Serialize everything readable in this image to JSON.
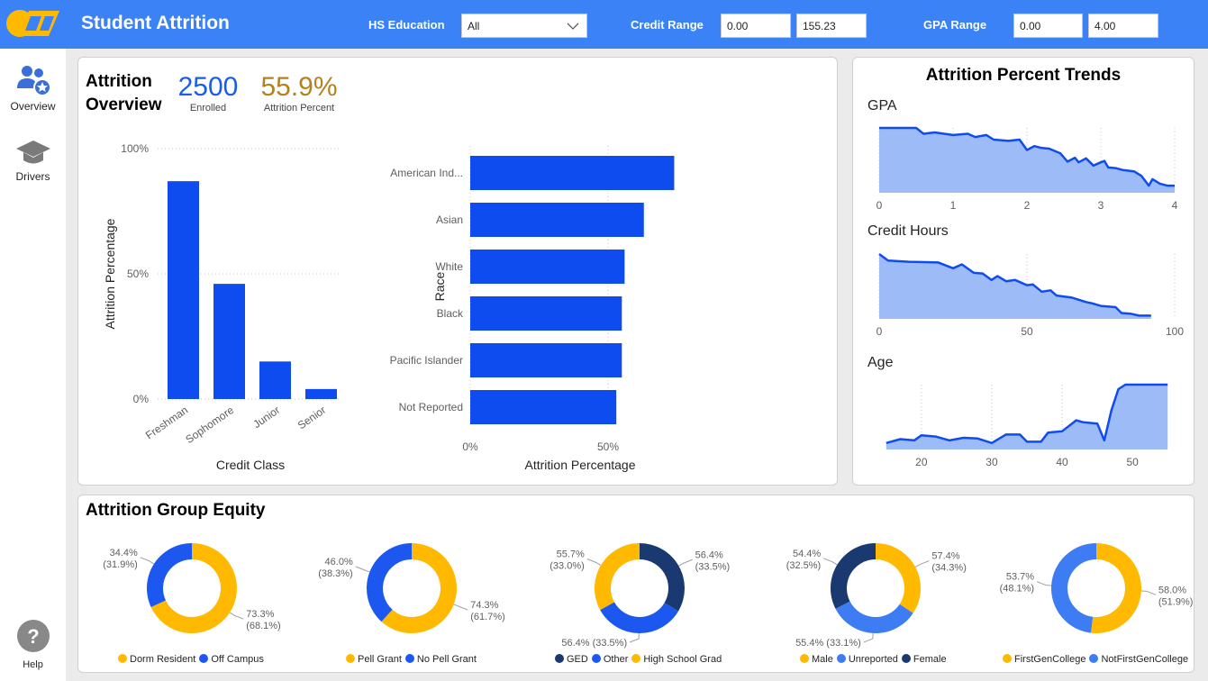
{
  "header": {
    "title": "Student Attrition",
    "hs_education_label": "HS Education",
    "hs_education_value": "All",
    "credit_range_label": "Credit Range",
    "credit_min": "0.00",
    "credit_max": "155.23",
    "gpa_range_label": "GPA Range",
    "gpa_min": "0.00",
    "gpa_max": "4.00"
  },
  "nav": {
    "overview_label": "Overview",
    "drivers_label": "Drivers",
    "help_label": "Help"
  },
  "overview": {
    "title_line1": "Attrition",
    "title_line2": "Overview",
    "enrolled_value": "2500",
    "enrolled_label": "Enrolled",
    "attrition_value": "55.9%",
    "attrition_label": "Attrition Percent",
    "kpi_colors": {
      "enrolled": "#1a5ce6",
      "attrition": "#b5811e"
    }
  },
  "trends": {
    "title": "Attrition Percent Trends",
    "gpa_label": "GPA",
    "credit_label": "Credit Hours",
    "age_label": "Age"
  },
  "equity": {
    "title": "Attrition Group Equity"
  },
  "colors": {
    "brand": "#3b82f6",
    "bar": "#0f4cf0",
    "area_fill": "#9dbcf7",
    "gold": "#ffb900",
    "blue": "#1c58f0",
    "mid_blue": "#3d7cf2",
    "navy": "#1a3970"
  },
  "chart_data": [
    {
      "type": "bar",
      "id": "credit-class",
      "categories": [
        "Freshman",
        "Sophomore",
        "Junior",
        "Senior"
      ],
      "values": [
        87,
        46,
        15,
        4
      ],
      "xlabel": "Credit Class",
      "ylabel": "Attrition Percentage",
      "ylim": [
        0,
        100
      ],
      "yticks": [
        "0%",
        "50%",
        "100%"
      ]
    },
    {
      "type": "bar",
      "id": "race",
      "orientation": "horizontal",
      "categories": [
        "American Ind...",
        "Asian",
        "White",
        "Black",
        "Pacific Islander",
        "Not Reported"
      ],
      "values": [
        74,
        63,
        56,
        55,
        55,
        53
      ],
      "xlabel": "Attrition Percentage",
      "ylabel": "Race",
      "xlim": [
        0,
        100
      ],
      "xticks": [
        "0%",
        "50%"
      ]
    },
    {
      "type": "area",
      "id": "gpa-trend",
      "x": [
        0,
        0.25,
        0.5,
        0.6,
        0.75,
        1.0,
        1.2,
        1.3,
        1.45,
        1.55,
        1.75,
        1.9,
        2.0,
        2.1,
        2.2,
        2.3,
        2.45,
        2.55,
        2.65,
        2.7,
        2.8,
        2.9,
        3.0,
        3.05,
        3.1,
        3.2,
        3.3,
        3.45,
        3.55,
        3.65,
        3.7,
        3.8,
        3.9,
        4.0
      ],
      "values": [
        100,
        100,
        100,
        91,
        93,
        89,
        91,
        86,
        89,
        82,
        80,
        82,
        66,
        72,
        69,
        68,
        61,
        48,
        54,
        47,
        53,
        42,
        47,
        49,
        39,
        38,
        35,
        33,
        26,
        11,
        21,
        14,
        11,
        11
      ],
      "xticks": [
        "0",
        "1",
        "2",
        "3",
        "4"
      ],
      "xlim": [
        0,
        4
      ],
      "ylim": [
        0,
        100
      ]
    },
    {
      "type": "area",
      "id": "credit-trend",
      "x": [
        0,
        3,
        10,
        20,
        25,
        28,
        32,
        35,
        38,
        40,
        43,
        46,
        50,
        52,
        55,
        58,
        60,
        65,
        70,
        72,
        75,
        80,
        82,
        85,
        88,
        92
      ],
      "values": [
        100,
        90,
        88,
        87,
        78,
        84,
        71,
        70,
        60,
        66,
        58,
        60,
        52,
        53,
        42,
        44,
        36,
        33,
        26,
        24,
        20,
        18,
        9,
        8,
        5,
        5
      ],
      "xticks": [
        "0",
        "50",
        "100"
      ],
      "xlim": [
        0,
        100
      ],
      "ylim": [
        0,
        100
      ]
    },
    {
      "type": "area",
      "id": "age-trend",
      "x": [
        15,
        17,
        19,
        20,
        22,
        24,
        26,
        28,
        30,
        32,
        34,
        35,
        37,
        38,
        40,
        42,
        43,
        45,
        46,
        47,
        48,
        49,
        50,
        52,
        55
      ],
      "values": [
        10,
        16,
        14,
        22,
        20,
        14,
        18,
        17,
        10,
        23,
        23,
        12,
        12,
        26,
        28,
        45,
        42,
        40,
        14,
        60,
        93,
        100,
        100,
        100,
        100
      ],
      "xticks": [
        "20",
        "30",
        "40",
        "50"
      ],
      "xlim": [
        14,
        56
      ],
      "ylim": [
        0,
        100
      ]
    },
    {
      "type": "pie",
      "id": "residence",
      "donut": true,
      "categories": [
        "Dorm Resident",
        "Off Campus"
      ],
      "values": [
        68.1,
        31.9
      ],
      "labels": [
        "73.3% (68.1%)",
        "34.4% (31.9%)"
      ],
      "colors": [
        "#ffb900",
        "#1c58f0"
      ]
    },
    {
      "type": "pie",
      "id": "pell",
      "donut": true,
      "categories": [
        "Pell Grant",
        "No Pell Grant"
      ],
      "values": [
        61.7,
        38.3
      ],
      "labels": [
        "74.3% (61.7%)",
        "46.0% (38.3%)"
      ],
      "colors": [
        "#ffb900",
        "#1c58f0"
      ]
    },
    {
      "type": "pie",
      "id": "hs-education",
      "donut": true,
      "categories": [
        "GED",
        "Other",
        "High School Grad"
      ],
      "values": [
        33.5,
        33.5,
        33.0
      ],
      "labels": [
        "56.4% (33.5%)",
        "56.4% (33.5%)",
        "55.7% (33.0%)"
      ],
      "colors": [
        "#1a3970",
        "#1c58f0",
        "#ffb900"
      ]
    },
    {
      "type": "pie",
      "id": "gender",
      "donut": true,
      "categories": [
        "Male",
        "Unreported",
        "Female"
      ],
      "values": [
        34.3,
        33.1,
        32.5
      ],
      "labels": [
        "57.4% (34.3%)",
        "55.4% (33.1%)",
        "54.4% (32.5%)"
      ],
      "colors": [
        "#ffb900",
        "#3d7cf2",
        "#1a3970"
      ]
    },
    {
      "type": "pie",
      "id": "first-gen",
      "donut": true,
      "categories": [
        "FirstGenCollege",
        "NotFirstGenCollege"
      ],
      "values": [
        51.9,
        48.1
      ],
      "labels": [
        "58.0% (51.9%)",
        "53.7% (48.1%)"
      ],
      "colors": [
        "#ffb900",
        "#3d7cf2"
      ]
    }
  ]
}
